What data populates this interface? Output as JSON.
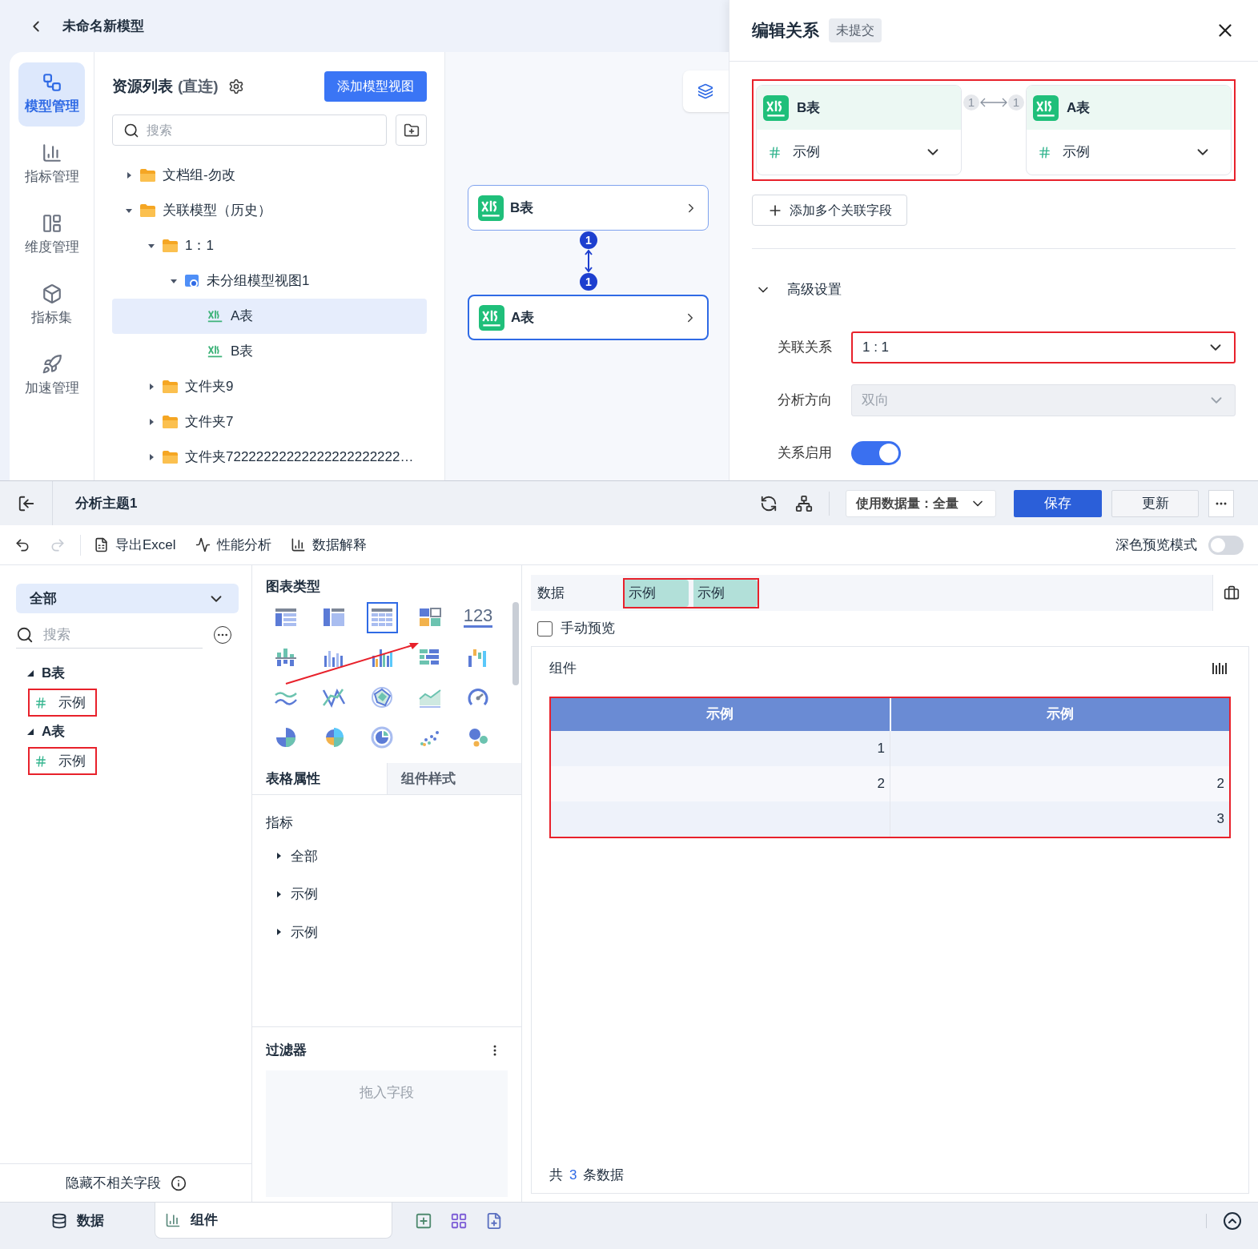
{
  "model_editor": {
    "title": "未命名新模型",
    "nav": [
      {
        "label": "模型管理",
        "selected": true
      },
      {
        "label": "指标管理",
        "selected": false
      },
      {
        "label": "维度管理",
        "selected": false
      },
      {
        "label": "指标集",
        "selected": false
      },
      {
        "label": "加速管理",
        "selected": false
      }
    ],
    "resources": {
      "title": "资源列表",
      "mode": "(直连)",
      "add_button": "添加模型视图",
      "search_placeholder": "搜索",
      "tree": [
        {
          "label": "文档组-勿改",
          "kind": "folder",
          "expanded": false,
          "selected": false
        },
        {
          "label": "关联模型（历史）",
          "kind": "folder",
          "expanded": true,
          "selected": false,
          "children": [
            {
              "label": "1：1",
              "kind": "folder",
              "expanded": true,
              "selected": false,
              "children": [
                {
                  "label": "未分组模型视图1",
                  "kind": "view",
                  "expanded": true,
                  "selected": false,
                  "children": [
                    {
                      "label": "A表",
                      "kind": "table",
                      "selected": true
                    },
                    {
                      "label": "B表",
                      "kind": "table",
                      "selected": false
                    }
                  ]
                }
              ]
            },
            {
              "label": "文件夹9",
              "kind": "folder",
              "expanded": false,
              "selected": false
            },
            {
              "label": "文件夹7",
              "kind": "folder",
              "expanded": false,
              "selected": false
            },
            {
              "label": "文件夹72222222222222222222222…",
              "kind": "folder",
              "expanded": false,
              "selected": false
            }
          ]
        }
      ]
    },
    "canvas": {
      "nodes": [
        {
          "label": "B表",
          "selected": false
        },
        {
          "label": "A表",
          "selected": true
        }
      ],
      "link": {
        "start": "1",
        "end": "1"
      }
    }
  },
  "relation_drawer": {
    "title": "编辑关系",
    "status": "未提交",
    "pair_highlighted": true,
    "left": {
      "table": "B表",
      "field": "示例"
    },
    "right": {
      "table": "A表",
      "field": "示例"
    },
    "left_count": "1",
    "right_count": "1",
    "add_field_button": "添加多个关联字段",
    "advanced": {
      "label": "高级设置",
      "expanded": true
    },
    "settings": [
      {
        "kind": "select",
        "label": "关联关系",
        "value": "1 : 1",
        "disabled": false,
        "highlighted": true
      },
      {
        "kind": "select",
        "label": "分析方向",
        "value": "双向",
        "disabled": true,
        "highlighted": false
      },
      {
        "kind": "toggle",
        "label": "关系启用",
        "on": true
      }
    ]
  },
  "analysis": {
    "title": "分析主题1",
    "data_volume": "使用数据量：全量",
    "save_button": "保存",
    "update_button": "更新",
    "toolbar": {
      "undo_disabled": false,
      "redo_disabled": true,
      "actions": [
        "导出Excel",
        "性能分析",
        "数据解释"
      ],
      "dark_mode": {
        "label": "深色预览模式",
        "on": false
      }
    },
    "fields_panel": {
      "scope": "全部",
      "search_placeholder": "搜索",
      "groups": [
        {
          "name": "B表",
          "expanded": true,
          "fields": [
            {
              "label": "示例",
              "highlighted": true
            }
          ]
        },
        {
          "name": "A表",
          "expanded": true,
          "fields": [
            {
              "label": "示例",
              "highlighted": true
            }
          ]
        }
      ],
      "hide_irrelevant": "隐藏不相关字段"
    },
    "chart_panel": {
      "title": "图表类型",
      "chart_types": [
        {
          "kind": "table",
          "selected": false
        },
        {
          "kind": "crosstab",
          "selected": false
        },
        {
          "kind": "detail",
          "selected": true
        },
        {
          "kind": "matrix",
          "selected": false
        },
        {
          "kind": "number",
          "label": "123",
          "selected": false
        },
        {
          "kind": "dotbar",
          "selected": false
        },
        {
          "kind": "bar",
          "selected": false
        },
        {
          "kind": "groupbar",
          "selected": false
        },
        {
          "kind": "hbar",
          "selected": false
        },
        {
          "kind": "waterfall",
          "selected": false
        },
        {
          "kind": "line",
          "selected": false
        },
        {
          "kind": "polyline",
          "selected": false
        },
        {
          "kind": "radar",
          "selected": false
        },
        {
          "kind": "area",
          "selected": false
        },
        {
          "kind": "gauge",
          "selected": false
        },
        {
          "kind": "pie",
          "selected": false
        },
        {
          "kind": "rose",
          "selected": false
        },
        {
          "kind": "ring",
          "selected": false
        },
        {
          "kind": "scatter",
          "selected": false
        },
        {
          "kind": "bubble",
          "selected": false
        }
      ],
      "tabs": [
        {
          "label": "表格属性",
          "selected": true
        },
        {
          "label": "组件样式",
          "selected": false
        }
      ],
      "metrics": {
        "title": "指标",
        "items": [
          {
            "label": "全部",
            "expanded": false
          },
          {
            "label": "示例",
            "expanded": false
          },
          {
            "label": "示例",
            "expanded": false
          }
        ]
      },
      "filter": {
        "title": "过滤器",
        "placeholder": "拖入字段"
      }
    },
    "preview": {
      "data_label": "数据",
      "chips": [
        "示例",
        "示例"
      ],
      "chips_highlighted": true,
      "manual_preview": {
        "label": "手动预览",
        "checked": false
      },
      "component_title": "组件",
      "table": {
        "highlighted": true,
        "columns": [
          "示例",
          "示例"
        ],
        "rows": [
          [
            "1",
            null
          ],
          [
            "2",
            "2"
          ],
          [
            null,
            "3"
          ]
        ]
      },
      "total": {
        "prefix": "共",
        "count": "3",
        "suffix": "条数据"
      }
    },
    "bottom_tabs": [
      {
        "label": "数据",
        "selected": false
      },
      {
        "label": "组件",
        "selected": true
      }
    ]
  }
}
